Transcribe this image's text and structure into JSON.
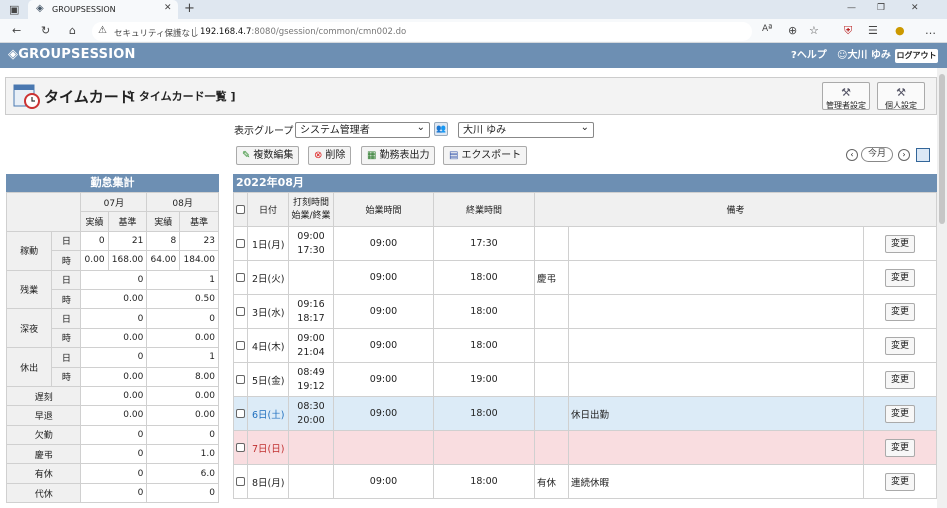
{
  "browser": {
    "tab_title": "GROUPSESSION",
    "security_label": "セキュリティ保護なし",
    "url_host": "192.168.4.7",
    "url_path": ":8080/gsession/common/cmn002.do"
  },
  "app": {
    "logo": "GROUPSESSION",
    "help": "ヘルプ",
    "user": "大川 ゆみ",
    "logout": "ログアウト"
  },
  "page": {
    "title": "タイムカード",
    "subtitle": "[ タイムカード一覧 ]",
    "admin_settings": "管理者設定",
    "personal_settings": "個人設定"
  },
  "filters": {
    "group_label": "表示グループ",
    "group_value": "システム管理者",
    "user_value": "大川 ゆみ"
  },
  "actions": {
    "bulk_edit": "複数編集",
    "delete": "削除",
    "attendance_output": "勤務表出力",
    "export": "エクスポート",
    "today": "今月"
  },
  "summary": {
    "title": "勤怠集計",
    "months": [
      "07月",
      "08月"
    ],
    "col_actual": "実績",
    "col_standard": "基準",
    "groups": [
      {
        "label": "稼動",
        "rows": [
          {
            "unit": "日",
            "v": [
              "0",
              "21",
              "8",
              "23"
            ]
          },
          {
            "unit": "時",
            "v": [
              "0.00",
              "168.00",
              "64.00",
              "184.00"
            ]
          }
        ]
      },
      {
        "label": "残業",
        "rows": [
          {
            "unit": "日",
            "v": [
              "0",
              "1"
            ]
          },
          {
            "unit": "時",
            "v": [
              "0.00",
              "0.50"
            ]
          }
        ]
      },
      {
        "label": "深夜",
        "rows": [
          {
            "unit": "日",
            "v": [
              "0",
              "0"
            ]
          },
          {
            "unit": "時",
            "v": [
              "0.00",
              "0.00"
            ]
          }
        ]
      },
      {
        "label": "休出",
        "rows": [
          {
            "unit": "日",
            "v": [
              "0",
              "1"
            ]
          },
          {
            "unit": "時",
            "v": [
              "0.00",
              "8.00"
            ]
          }
        ]
      }
    ],
    "singles": [
      {
        "label": "遅刻",
        "v": [
          "0.00",
          "0.00"
        ]
      },
      {
        "label": "早退",
        "v": [
          "0.00",
          "0.00"
        ]
      },
      {
        "label": "欠勤",
        "v": [
          "0",
          "0"
        ]
      },
      {
        "label": "慶弔",
        "v": [
          "0",
          "1.0"
        ]
      },
      {
        "label": "有休",
        "v": [
          "0",
          "6.0"
        ]
      },
      {
        "label": "代休",
        "v": [
          "0",
          "0"
        ]
      }
    ]
  },
  "timecard": {
    "month_title": "2022年08月",
    "headers": {
      "date": "日付",
      "stamp": "打刻時間\n始業/終業",
      "start": "始業時間",
      "end": "終業時間",
      "remarks": "備考"
    },
    "change_label": "変更",
    "rows": [
      {
        "date": "1日(月)",
        "stamp1": "09:00",
        "stamp2": "17:30",
        "start": "09:00",
        "end": "17:30",
        "kind": "",
        "note": "",
        "type": ""
      },
      {
        "date": "2日(火)",
        "stamp1": "",
        "stamp2": "",
        "start": "09:00",
        "end": "18:00",
        "kind": "慶弔",
        "note": "",
        "type": ""
      },
      {
        "date": "3日(水)",
        "stamp1": "09:16",
        "stamp2": "18:17",
        "start": "09:00",
        "end": "18:00",
        "kind": "",
        "note": "",
        "type": ""
      },
      {
        "date": "4日(木)",
        "stamp1": "09:00",
        "stamp2": "21:04",
        "start": "09:00",
        "end": "18:00",
        "kind": "",
        "note": "",
        "type": ""
      },
      {
        "date": "5日(金)",
        "stamp1": "08:49",
        "stamp2": "19:12",
        "start": "09:00",
        "end": "19:00",
        "kind": "",
        "note": "",
        "type": ""
      },
      {
        "date": "6日(土)",
        "stamp1": "08:30",
        "stamp2": "20:00",
        "start": "09:00",
        "end": "18:00",
        "kind": "",
        "note": "休日出勤",
        "type": "sat"
      },
      {
        "date": "7日(日)",
        "stamp1": "",
        "stamp2": "",
        "start": "",
        "end": "",
        "kind": "",
        "note": "",
        "type": "sun"
      },
      {
        "date": "8日(月)",
        "stamp1": "",
        "stamp2": "",
        "start": "09:00",
        "end": "18:00",
        "kind": "有休",
        "note": "連続休暇",
        "type": ""
      }
    ]
  }
}
